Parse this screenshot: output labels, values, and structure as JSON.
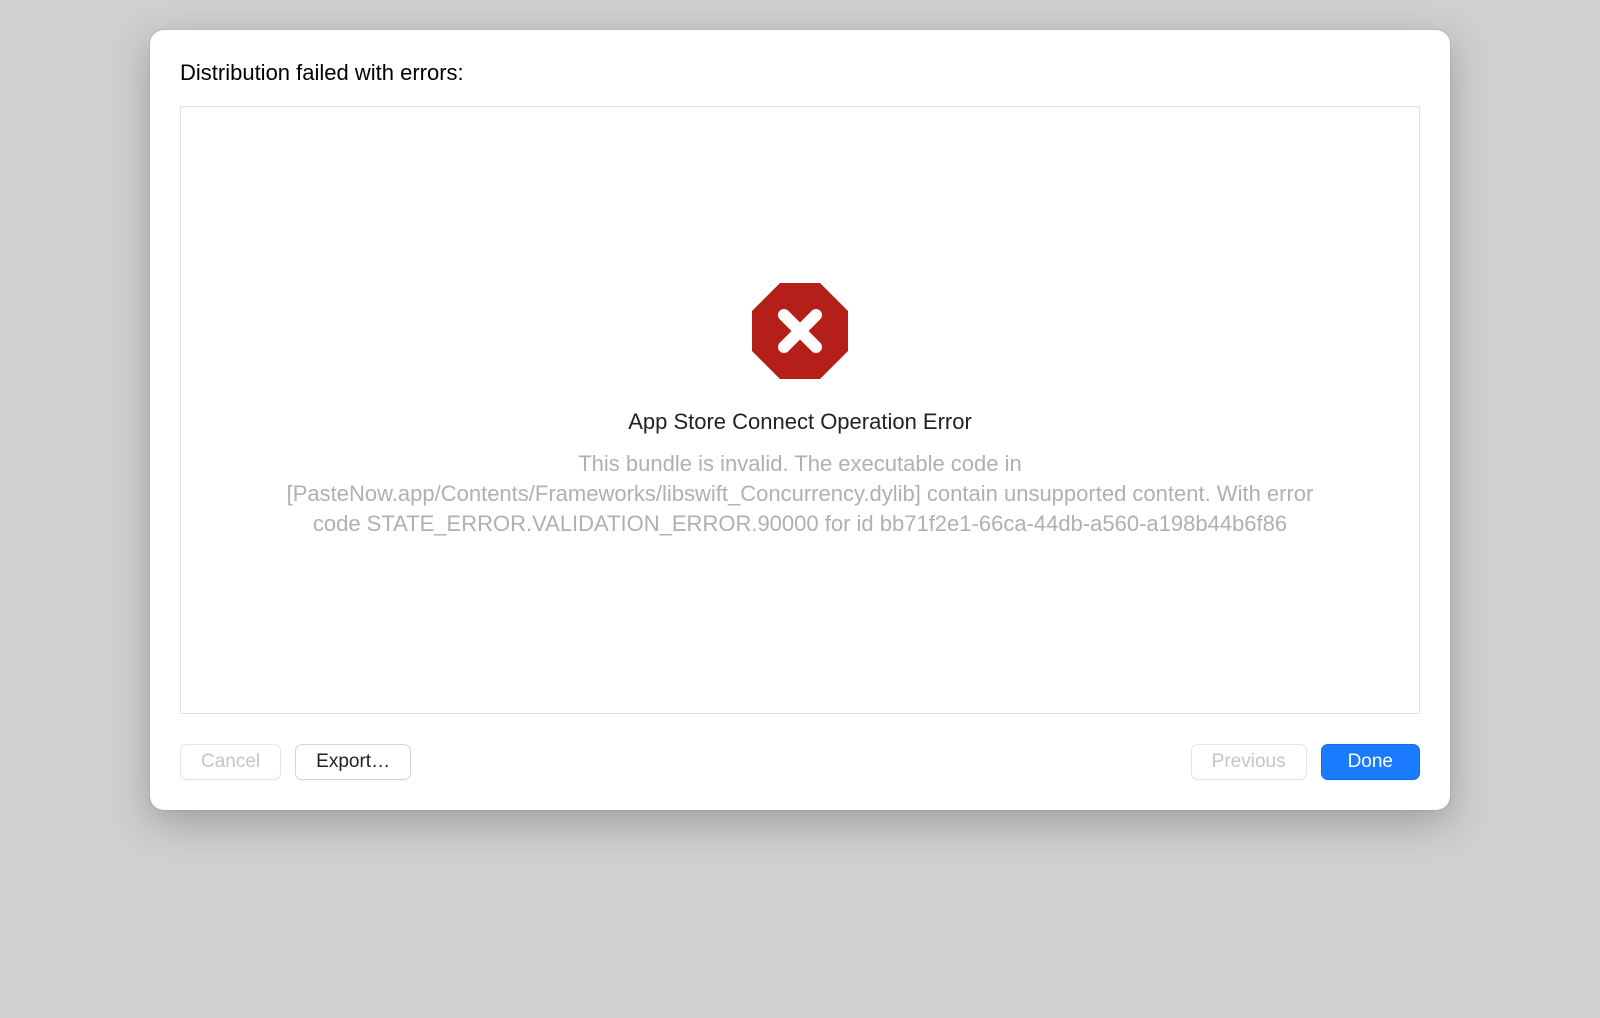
{
  "dialog": {
    "title": "Distribution failed with errors:"
  },
  "error": {
    "icon_name": "stop-x-icon",
    "title": "App Store Connect Operation Error",
    "description": "This bundle is invalid. The executable code in [PasteNow.app/Contents/Frameworks/libswift_Concurrency.dylib] contain unsupported content. With error code STATE_ERROR.VALIDATION_ERROR.90000 for id bb71f2e1-66ca-44db-a560-a198b44b6f86"
  },
  "buttons": {
    "cancel": "Cancel",
    "export": "Export…",
    "previous": "Previous",
    "done": "Done"
  },
  "colors": {
    "error_red": "#b42019",
    "primary_blue": "#1b7bff",
    "desc_gray": "#b0b0b0"
  }
}
